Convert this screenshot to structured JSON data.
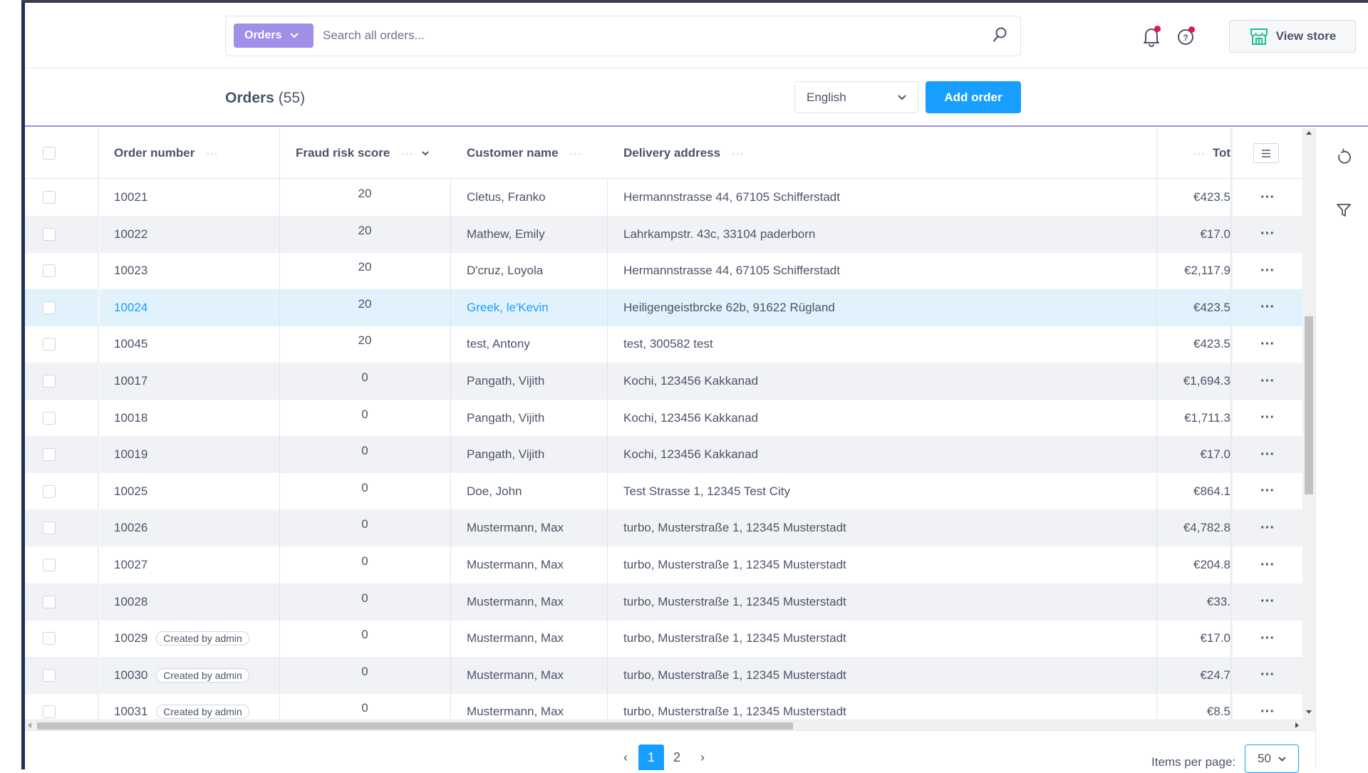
{
  "header": {
    "search_scope": "Orders",
    "search_placeholder": "Search all orders...",
    "view_store_label": "View store"
  },
  "subheader": {
    "title": "Orders",
    "count": "(55)",
    "language": "English",
    "add_order_label": "Add order"
  },
  "colors": {
    "accent": "#189eff",
    "brand": "#a08ee8",
    "notification": "#e3184a",
    "store_icon": "#1dbf8d"
  },
  "table": {
    "columns": [
      "Order number",
      "Fraud risk score",
      "Customer name",
      "Delivery address",
      "Tot"
    ],
    "rows": [
      {
        "order": "10021",
        "score": "20",
        "customer": "Cletus, Franko",
        "address": "Hermannstrasse 44, 67105 Schifferstadt",
        "total": "€423.5"
      },
      {
        "order": "10022",
        "score": "20",
        "customer": "Mathew, Emily",
        "address": "Lahrkampstr. 43c, 33104 paderborn",
        "total": "€17.0"
      },
      {
        "order": "10023",
        "score": "20",
        "customer": "D'cruz, Loyola",
        "address": "Hermannstrasse 44, 67105 Schifferstadt",
        "total": "€2,117.9"
      },
      {
        "order": "10024",
        "score": "20",
        "customer": "Greek, le'Kevin",
        "address": "Heiligengeistbrcke 62b, 91622 Rügland",
        "total": "€423.5",
        "selected": true
      },
      {
        "order": "10045",
        "score": "20",
        "customer": "test, Antony",
        "address": "test, 300582 test",
        "total": "€423.5"
      },
      {
        "order": "10017",
        "score": "0",
        "customer": "Pangath, Vijith",
        "address": "Kochi, 123456 Kakkanad",
        "total": "€1,694.3"
      },
      {
        "order": "10018",
        "score": "0",
        "customer": "Pangath, Vijith",
        "address": "Kochi, 123456 Kakkanad",
        "total": "€1,711.3"
      },
      {
        "order": "10019",
        "score": "0",
        "customer": "Pangath, Vijith",
        "address": "Kochi, 123456 Kakkanad",
        "total": "€17.0"
      },
      {
        "order": "10025",
        "score": "0",
        "customer": "Doe, John",
        "address": "Test Strasse 1, 12345 Test City",
        "total": "€864.1"
      },
      {
        "order": "10026",
        "score": "0",
        "customer": "Mustermann, Max",
        "address": "turbo, Musterstraße 1, 12345 Musterstadt",
        "total": "€4,782.8"
      },
      {
        "order": "10027",
        "score": "0",
        "customer": "Mustermann, Max",
        "address": "turbo, Musterstraße 1, 12345 Musterstadt",
        "total": "€204.8"
      },
      {
        "order": "10028",
        "score": "0",
        "customer": "Mustermann, Max",
        "address": "turbo, Musterstraße 1, 12345 Musterstadt",
        "total": "€33."
      },
      {
        "order": "10029",
        "badge": "Created by admin",
        "score": "0",
        "customer": "Mustermann, Max",
        "address": "turbo, Musterstraße 1, 12345 Musterstadt",
        "total": "€17.0"
      },
      {
        "order": "10030",
        "badge": "Created by admin",
        "score": "0",
        "customer": "Mustermann, Max",
        "address": "turbo, Musterstraße 1, 12345 Musterstadt",
        "total": "€24.7"
      },
      {
        "order": "10031",
        "badge": "Created by admin",
        "score": "0",
        "customer": "Mustermann, Max",
        "address": "turbo, Musterstraße 1, 12345 Musterstadt",
        "total": "€8.5"
      }
    ],
    "row_actions": "···"
  },
  "footer": {
    "pages": [
      "1",
      "2"
    ],
    "current_page": "1",
    "items_per_page_label": "Items per page:",
    "items_per_page": "50"
  }
}
